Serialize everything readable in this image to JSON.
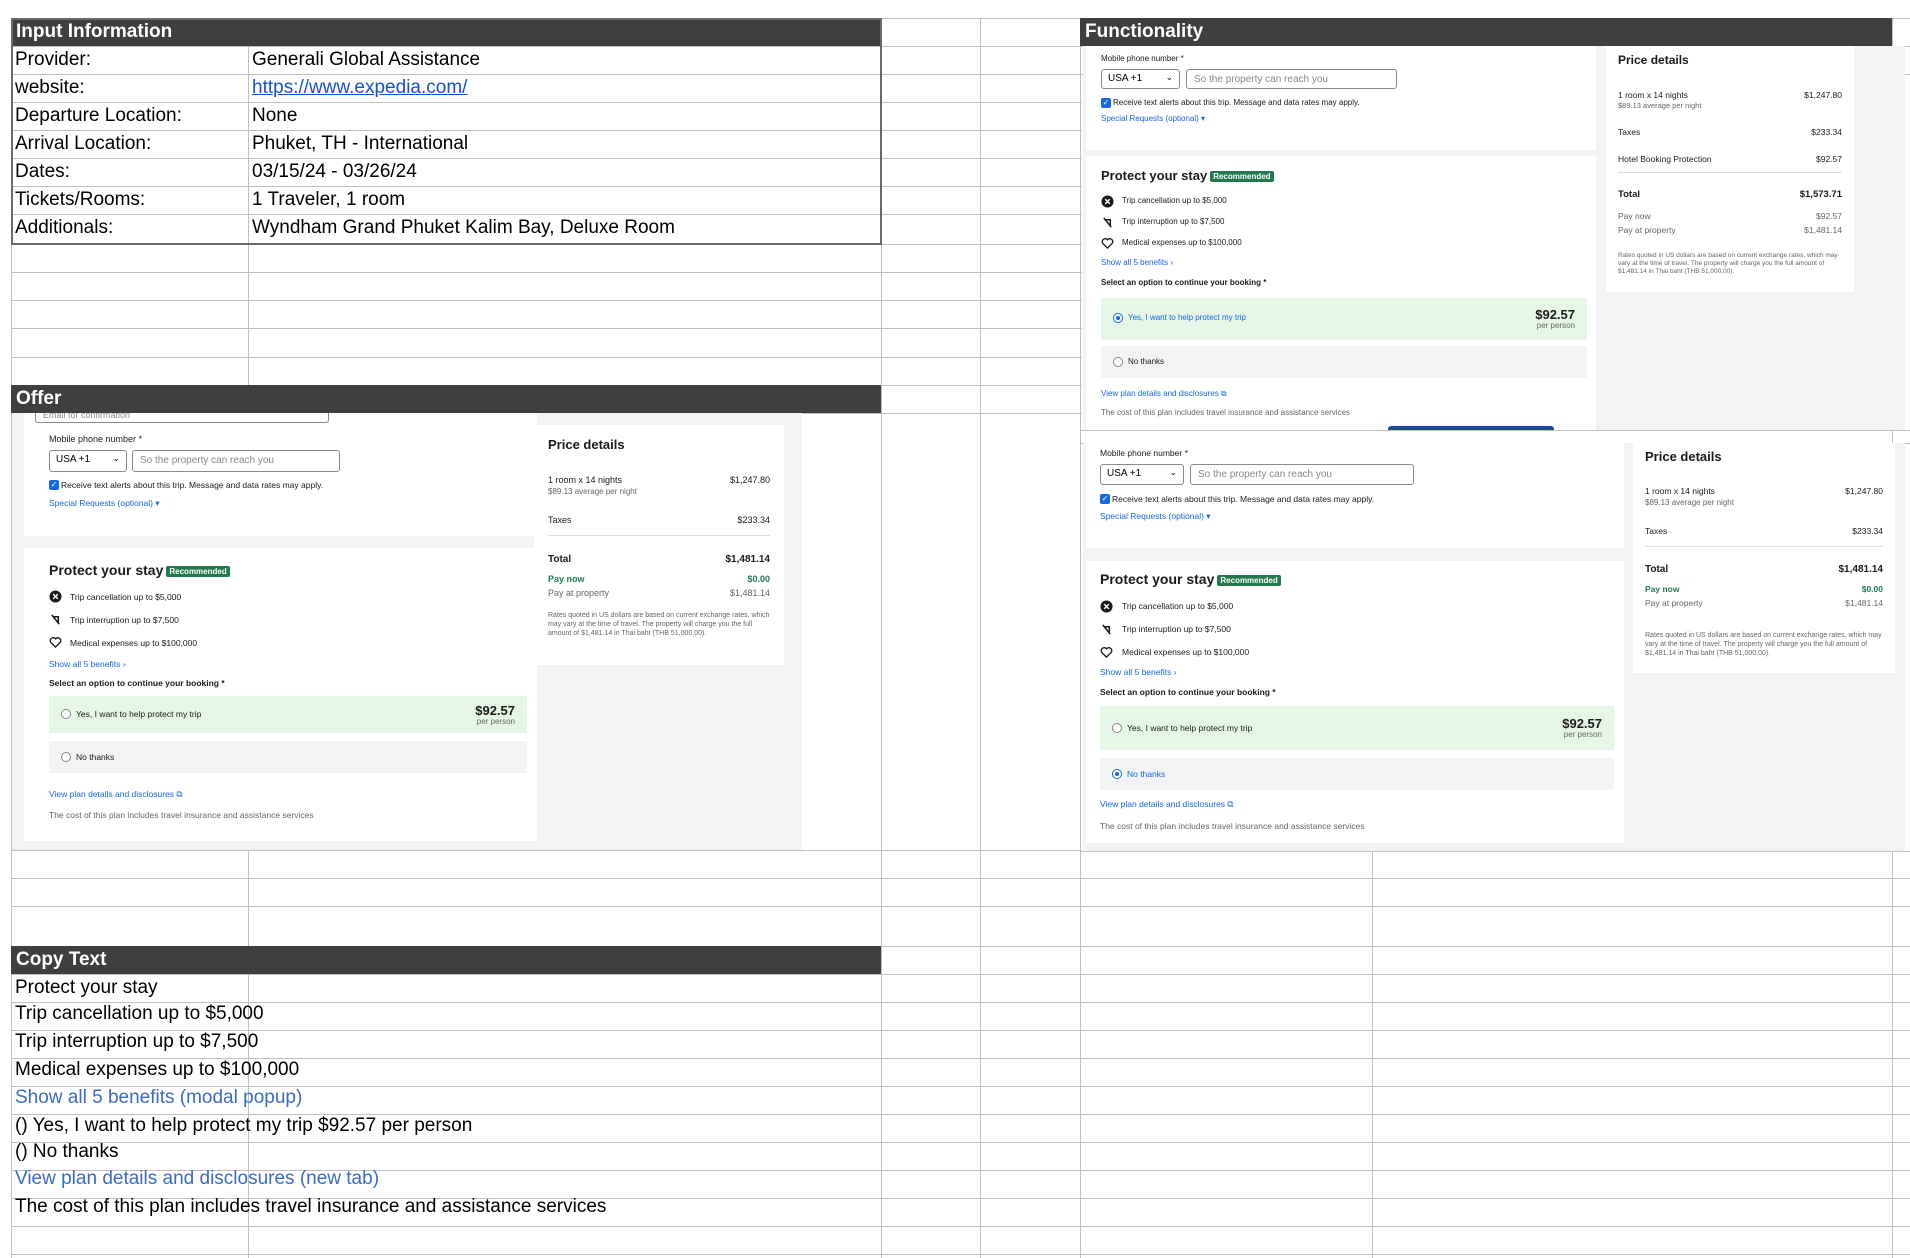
{
  "sections": {
    "input_info": "Input Information",
    "functionality": "Functionality",
    "offer": "Offer",
    "copy_text": "Copy Text"
  },
  "input_info": [
    {
      "label": "Provider:",
      "value": "Generali Global Assistance"
    },
    {
      "label": "website:",
      "value": "https://www.expedia.com/",
      "link": true
    },
    {
      "label": "Departure Location:",
      "value": "None"
    },
    {
      "label": "Arrival Location:",
      "value": "Phuket, TH - International"
    },
    {
      "label": "Dates:",
      "value": "03/15/24 - 03/26/24"
    },
    {
      "label": "Tickets/Rooms:",
      "value": "1 Traveler, 1 room"
    },
    {
      "label": "Additionals:",
      "value": "Wyndham Grand Phuket Kalim Bay, Deluxe Room"
    }
  ],
  "copy_text": [
    {
      "text": "Protect your stay",
      "link": false
    },
    {
      "text": "Trip cancellation up to $5,000",
      "link": false
    },
    {
      "text": "Trip interruption up to $7,500",
      "link": false
    },
    {
      "text": "Medical expenses up to $100,000",
      "link": false
    },
    {
      "text": "Show all 5 benefits (modal popup)",
      "link": true
    },
    {
      "text": "() Yes, I want to help protect my trip $92.57 per person",
      "link": false
    },
    {
      "text": "() No thanks",
      "link": false
    },
    {
      "text": "View plan details and disclosures (new tab)",
      "link": true
    },
    {
      "text": "The cost of this plan includes travel insurance and assistance services",
      "link": false
    }
  ],
  "shot": {
    "email_placeholder": "Email for confirmation",
    "phone_label": "Mobile phone number *",
    "country_code": "USA +1",
    "phone_placeholder": "So the property can reach you",
    "text_alerts": "Receive text alerts about this trip. Message and data rates may apply.",
    "special_requests": "Special Requests (optional) ▾",
    "protect_title": "Protect your stay",
    "recommended": "Recommended",
    "benefit_1": "Trip cancellation up to $5,000",
    "benefit_2": "Trip interruption up to $7,500",
    "benefit_3": "Medical expenses up to $100,000",
    "show_all": "Show all 5 benefits ›",
    "select_option": "Select an option to continue your booking *",
    "yes_option": "Yes, I want to help protect my trip",
    "yes_price": "$92.57",
    "per_person": "per person",
    "no_option": "No thanks",
    "view_plan": "View plan details and disclosures ⧉",
    "cost_note": "The cost of this plan includes travel insurance and assistance services",
    "price_details": "Price details",
    "room_line": "1 room x 14 nights",
    "room_price": "$1,247.80",
    "avg_night": "$89.13 average per night",
    "taxes": "Taxes",
    "taxes_price": "$233.34",
    "protection": "Hotel Booking Protection",
    "protection_price": "$92.57",
    "total": "Total",
    "total_with": "$1,573.71",
    "total_without": "$1,481.14",
    "pay_now": "Pay now",
    "pay_now_zero": "$0.00",
    "pay_now_protect": "$92.57",
    "pay_property": "Pay at property",
    "pay_property_price": "$1,481.14",
    "rates_note": "Rates quoted in US dollars are based on current exchange rates, which may vary at the time of travel. The property will charge you the full amount of $1,481.14 in Thai baht (THB 51,000.00)."
  }
}
